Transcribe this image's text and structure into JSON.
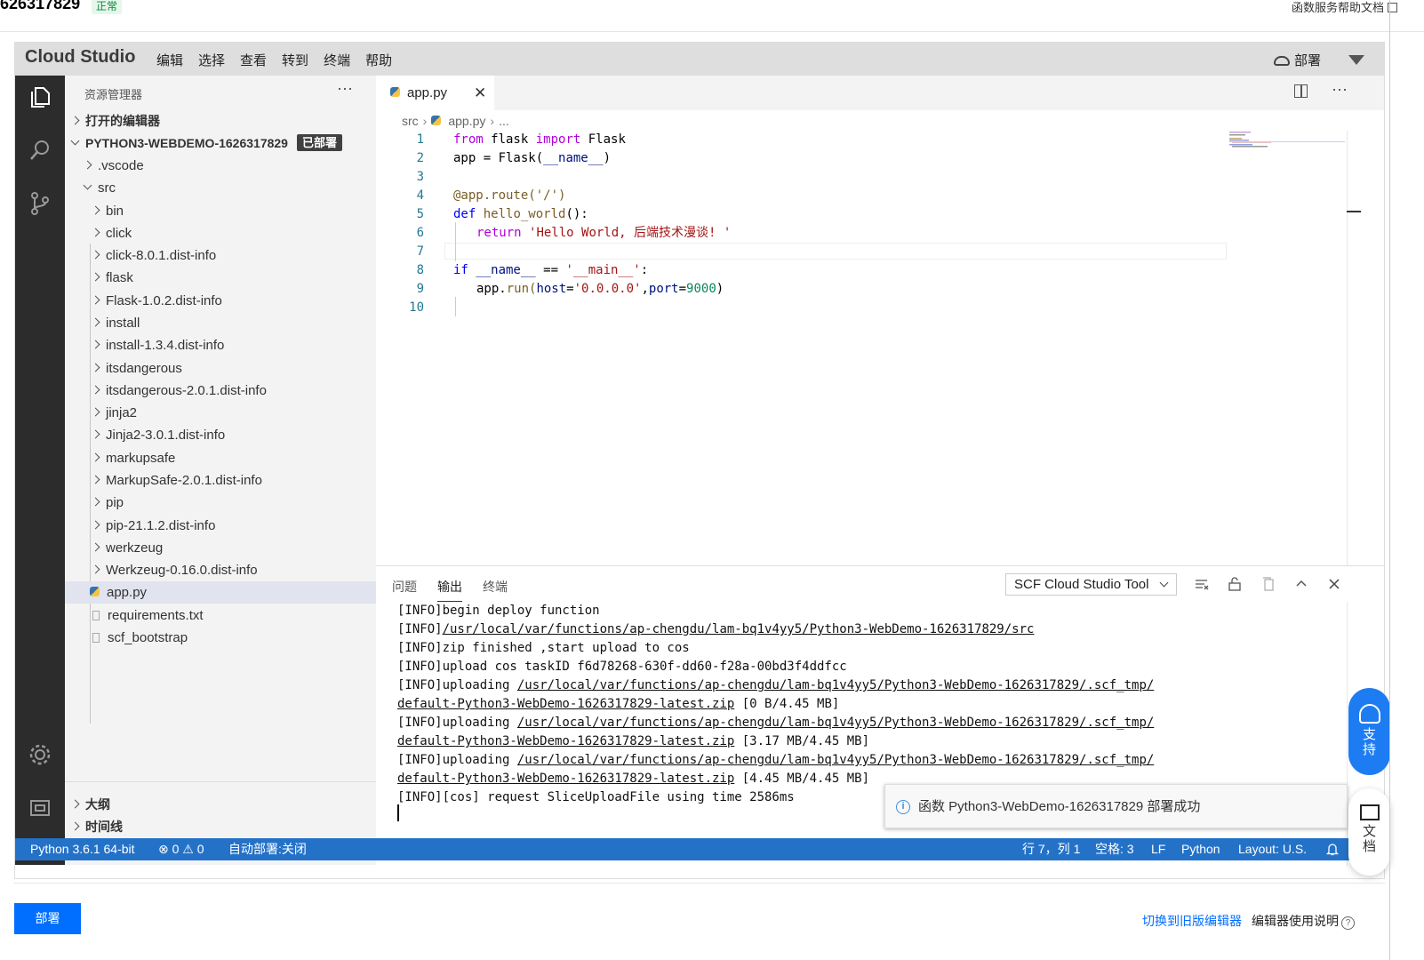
{
  "page": {
    "function_id": "626317829",
    "function_status": "正常",
    "help_doc": "函数服务帮助文档"
  },
  "ide": {
    "logo": "Cloud Studio",
    "menu": [
      "编辑",
      "选择",
      "查看",
      "转到",
      "终端",
      "帮助"
    ],
    "deploy_label": "部署"
  },
  "sidebar": {
    "title": "资源管理器",
    "more": "···",
    "open_editors": "打开的编辑器",
    "project": "PYTHON3-WEBDEMO-1626317829",
    "project_badge": "已部署",
    "items": [
      ".vscode",
      "src",
      "bin",
      "click",
      "click-8.0.1.dist-info",
      "flask",
      "Flask-1.0.2.dist-info",
      "install",
      "install-1.3.4.dist-info",
      "itsdangerous",
      "itsdangerous-2.0.1.dist-info",
      "jinja2",
      "Jinja2-3.0.1.dist-info",
      "markupsafe",
      "MarkupSafe-2.0.1.dist-info",
      "pip",
      "pip-21.1.2.dist-info",
      "werkzeug",
      "Werkzeug-0.16.0.dist-info",
      "app.py",
      "requirements.txt",
      "scf_bootstrap"
    ],
    "outline": "大纲",
    "timeline": "时间线"
  },
  "editor": {
    "tab": "app.py",
    "tab_close": "✕",
    "more": "···",
    "breadcrumb": [
      "src",
      "app.py",
      "..."
    ],
    "line_numbers": [
      "1",
      "2",
      "3",
      "4",
      "5",
      "6",
      "7",
      "8",
      "9",
      "10"
    ],
    "code": {
      "l1_from": "from",
      "l1_mod": " flask ",
      "l1_import": "import",
      "l1_cls": " Flask",
      "l2_a": "app = ",
      "l2_b": "Flask(",
      "l2_c": "__name__",
      "l2_d": ")",
      "l4": "@app.route('/')",
      "l5_def": "def",
      "l5_fn": " hello_world",
      "l5_rest": "():",
      "l6_ret": "return",
      "l6_str": "'Hello World, 后端技术漫谈! '",
      "l8_if": "if",
      "l8_a": " __name__",
      "l8_b": " == ",
      "l8_c": "'__main__'",
      "l8_d": ":",
      "l9_a": "app.",
      "l9_b": "run(",
      "l9_c": "host",
      "l9_d": "=",
      "l9_e": "'0.0.0.0'",
      "l9_f": ",",
      "l9_g": "port",
      "l9_h": "=",
      "l9_i": "9000",
      "l9_j": ")"
    }
  },
  "panel": {
    "tabs": [
      "问题",
      "输出",
      "终端"
    ],
    "output_select": "SCF Cloud Studio Tool",
    "log": [
      {
        "pre": "[INFO]begin deploy function",
        "link": "",
        "post": ""
      },
      {
        "pre": "[INFO]",
        "link": "/usr/local/var/functions/ap-chengdu/lam-bq1v4yy5/Python3-WebDemo-1626317829/src",
        "post": ""
      },
      {
        "pre": "[INFO]zip finished ,start upload to cos",
        "link": "",
        "post": ""
      },
      {
        "pre": "[INFO]upload cos taskID f6d78268-630f-dd60-f28a-00bd3f4ddfcc",
        "link": "",
        "post": ""
      },
      {
        "pre": "[INFO]uploading ",
        "link": "/usr/local/var/functions/ap-chengdu/lam-bq1v4yy5/Python3-WebDemo-1626317829/.scf_tmp/",
        "post": ""
      },
      {
        "pre": "",
        "link": "default-Python3-WebDemo-1626317829-latest.zip",
        "post": " [0 B/4.45 MB]"
      },
      {
        "pre": "[INFO]uploading ",
        "link": "/usr/local/var/functions/ap-chengdu/lam-bq1v4yy5/Python3-WebDemo-1626317829/.scf_tmp/",
        "post": ""
      },
      {
        "pre": "",
        "link": "default-Python3-WebDemo-1626317829-latest.zip",
        "post": " [3.17 MB/4.45 MB]"
      },
      {
        "pre": "[INFO]uploading ",
        "link": "/usr/local/var/functions/ap-chengdu/lam-bq1v4yy5/Python3-WebDemo-1626317829/.scf_tmp/",
        "post": ""
      },
      {
        "pre": "",
        "link": "default-Python3-WebDemo-1626317829-latest.zip",
        "post": " [4.45 MB/4.45 MB]"
      },
      {
        "pre": "[INFO][cos] request SliceUploadFile using time 2586ms",
        "link": "",
        "post": ""
      }
    ]
  },
  "toast": {
    "message": "函数 Python3-WebDemo-1626317829 部署成功"
  },
  "statusbar": {
    "python": "Python 3.6.1 64-bit",
    "problems": "⊗ 0 ⚠ 0",
    "auto_deploy": "自动部署:关闭",
    "position": "行 7，列 1",
    "spaces": "空格: 3",
    "eol": "LF",
    "language": "Python",
    "layout": "Layout: U.S."
  },
  "float": {
    "support": [
      "支",
      "持"
    ],
    "docs": [
      "文",
      "档"
    ]
  },
  "footer": {
    "deploy_button": "部署",
    "switch_old": "切换到旧版编辑器",
    "editor_help": "编辑器使用说明"
  }
}
